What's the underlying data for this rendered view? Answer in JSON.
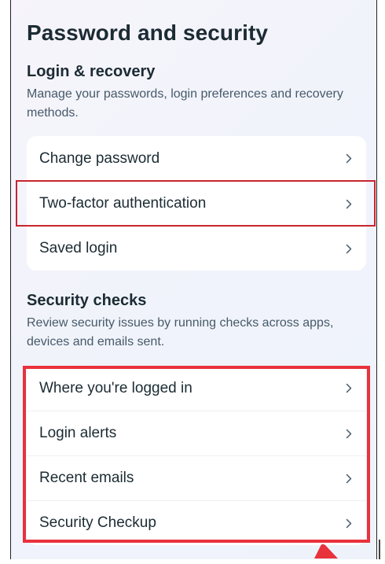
{
  "page": {
    "title": "Password and security"
  },
  "login_recovery": {
    "title": "Login & recovery",
    "description": "Manage your passwords, login preferences and recovery methods.",
    "items": [
      {
        "label": "Change password"
      },
      {
        "label": "Two-factor authentication"
      },
      {
        "label": "Saved login"
      }
    ]
  },
  "security_checks": {
    "title": "Security checks",
    "description": "Review security issues by running checks across apps, devices and emails sent.",
    "items": [
      {
        "label": "Where you're logged in"
      },
      {
        "label": "Login alerts"
      },
      {
        "label": "Recent emails"
      },
      {
        "label": "Security Checkup"
      }
    ]
  },
  "icons": {
    "row_chevron": "chevron-right-icon"
  },
  "colors": {
    "highlight_outline": "#c9252f",
    "highlight_box": "#e8323c",
    "text_primary": "#1c2b33",
    "text_secondary": "#465a69"
  }
}
